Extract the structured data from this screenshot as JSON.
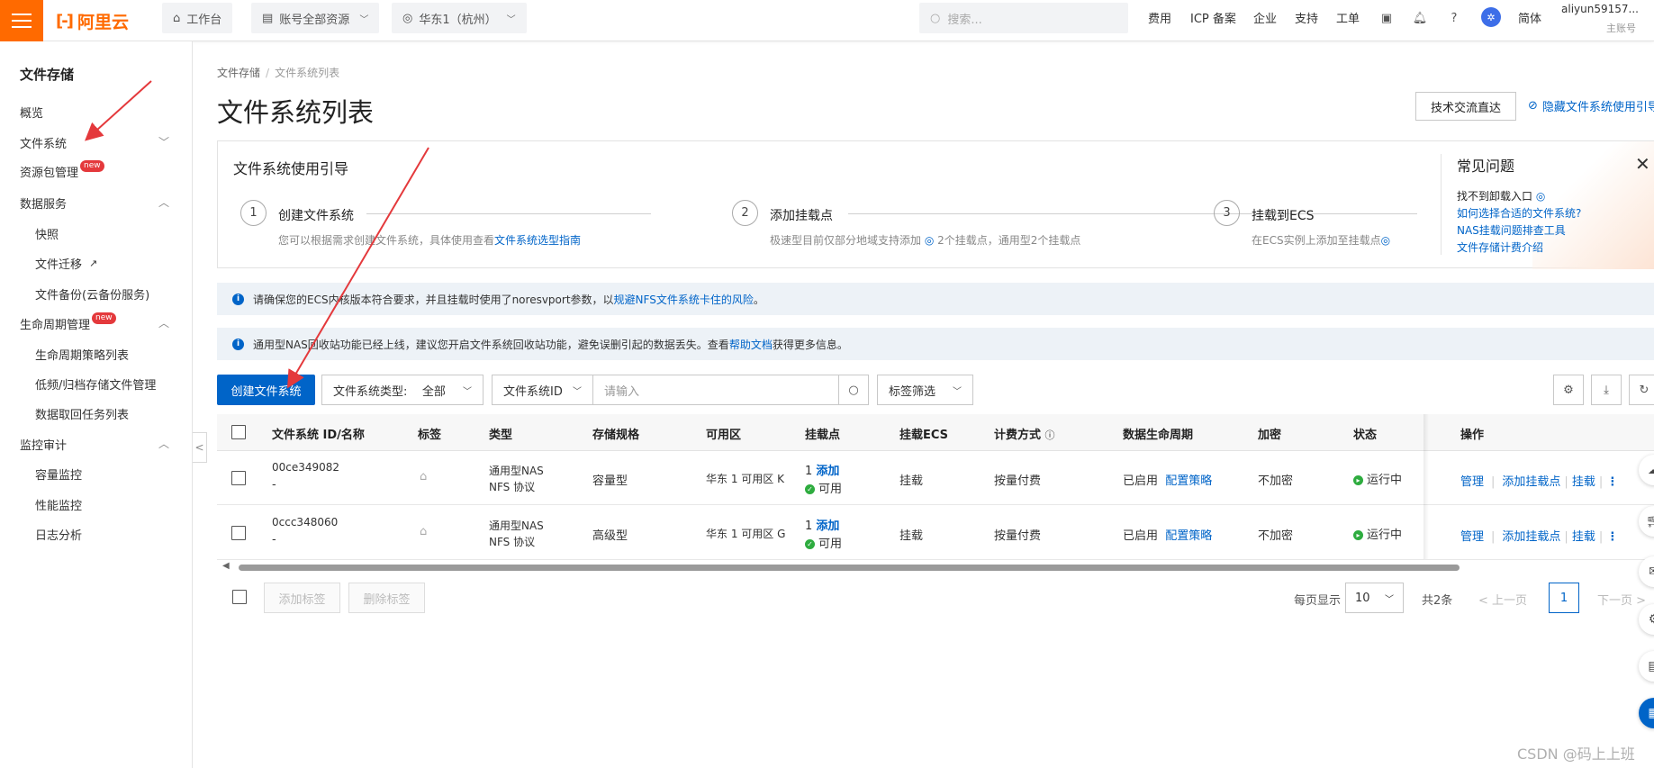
{
  "topbar": {
    "logo_text": "阿里云",
    "workbench": "工作台",
    "account_resources": "账号全部资源",
    "region": "华东1（杭州）",
    "search_placeholder": "搜索...",
    "nav": [
      "费用",
      "ICP 备案",
      "企业",
      "支持",
      "工单"
    ],
    "language": "简体",
    "user_name": "aliyun59157...",
    "user_role": "主账号"
  },
  "sidebar": {
    "title": "文件存储",
    "items": {
      "overview": "概览",
      "file_system": "文件系统",
      "resource_pkg": "资源包管理",
      "data_service": "数据服务",
      "snapshot": "快照",
      "migration": "文件迁移",
      "backup": "文件备份(云备份服务)",
      "lifecycle": "生命周期管理",
      "lifecycle_policy": "生命周期策略列表",
      "low_freq": "低频/归档存储文件管理",
      "data_retrieval": "数据取回任务列表",
      "monitor": "监控审计",
      "capacity": "容量监控",
      "performance": "性能监控",
      "log": "日志分析"
    },
    "new_badge": "new"
  },
  "breadcrumb": {
    "root": "文件存储",
    "current": "文件系统列表"
  },
  "page_title": "文件系统列表",
  "tech_button": "技术交流直达",
  "hide_guide": "隐藏文件系统使用引导",
  "guide": {
    "title": "文件系统使用引导",
    "steps": [
      {
        "num": "1",
        "title": "创建文件系统",
        "desc": "您可以根据需求创建文件系统，具体使用查看",
        "link": "文件系统选型指南"
      },
      {
        "num": "2",
        "title": "添加挂载点",
        "desc": "极速型目前仅部分地域支持添加",
        "desc2": "2个挂载点，通用型2个挂载点"
      },
      {
        "num": "3",
        "title": "挂载到ECS",
        "desc": "在ECS实例上添加至挂载点"
      }
    ],
    "faq_title": "常见问题",
    "faq": [
      "找不到卸载入口",
      "如何选择合适的文件系统?",
      "NAS挂载问题排查工具",
      "文件存储计费介绍"
    ]
  },
  "notices": {
    "n1_text": "请确保您的ECS内核版本符合要求，并且挂载时使用了noresvport参数，以",
    "n1_link": "规避NFS文件系统卡住的风险",
    "n1_end": "。",
    "n2_text": "通用型NAS回收站功能已经上线，建议您开启文件系统回收站功能，避免误删引起的数据丢失。查看",
    "n2_link": "帮助文档",
    "n2_end": "获得更多信息。"
  },
  "toolbar": {
    "create": "创建文件系统",
    "fs_type_label": "文件系统类型:",
    "fs_type_value": "全部",
    "id_filter": "文件系统ID",
    "input_placeholder": "请输入",
    "tag_filter": "标签筛选"
  },
  "table": {
    "headers": [
      "文件系统 ID/名称",
      "标签",
      "类型",
      "存储规格",
      "可用区",
      "挂载点",
      "挂载ECS",
      "计费方式",
      "数据生命周期",
      "加密",
      "状态",
      "操作"
    ],
    "rows": [
      {
        "id": "00ce349082",
        "name": "-",
        "type1": "通用型NAS",
        "type2": "NFS 协议",
        "spec": "容量型",
        "zone": "华东 1 可用区 K",
        "mount_count": "1",
        "mount_add": "添加",
        "mount_status": "可用",
        "ecs": "挂载",
        "billing": "按量付费",
        "lifecycle": "已启用",
        "lifecycle_link": "配置策略",
        "encrypt": "不加密",
        "status": "运行中",
        "ops": [
          "管理",
          "添加挂载点",
          "挂载"
        ]
      },
      {
        "id": "0ccc348060",
        "name": "-",
        "type1": "通用型NAS",
        "type2": "NFS 协议",
        "spec": "高级型",
        "zone": "华东 1 可用区 G",
        "mount_count": "1",
        "mount_add": "添加",
        "mount_status": "可用",
        "ecs": "挂载",
        "billing": "按量付费",
        "lifecycle": "已启用",
        "lifecycle_link": "配置策略",
        "encrypt": "不加密",
        "status": "运行中",
        "ops": [
          "管理",
          "添加挂载点",
          "挂载"
        ]
      }
    ]
  },
  "footer": {
    "add_tag": "添加标签",
    "remove_tag": "删除标签",
    "per_page_label": "每页显示",
    "per_page": "10",
    "total": "共2条",
    "prev": "上一页",
    "page": "1",
    "next": "下一页"
  },
  "watermark": "CSDN @码上上班",
  "colors": {
    "brand": "#ff6a00",
    "primary": "#0064c8",
    "annotation": "#e4393c"
  }
}
